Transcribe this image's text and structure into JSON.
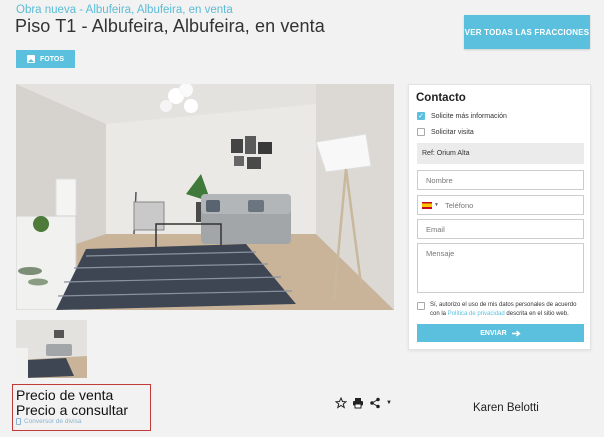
{
  "breadcrumb": "Obra nueva - Albufeira, Albufeira, en venta",
  "title": "Piso T1 - Albufeira, Albufeira, en venta",
  "all_fractions_button": "VER TODAS LAS FRACCIONES",
  "photos_button": "FOTOS",
  "contact": {
    "heading": "Contacto",
    "option_info": "Solicite más información",
    "option_info_checked": true,
    "option_visit": "Solicitar visita",
    "option_visit_checked": false,
    "reference": "Ref: Orium Alta",
    "name_placeholder": "Nombre",
    "phone_placeholder": "Teléfono",
    "email_placeholder": "Email",
    "message_placeholder": "Mensaje",
    "privacy_text_1": "Sí, autorizo el uso de mis datos personales de acuerdo con la ",
    "privacy_link": "Política de privacidad",
    "privacy_text_2": " descrita en el sitio web.",
    "send_button": "ENVIAR"
  },
  "price": {
    "label": "Precio de venta",
    "value": "Precio a consultar",
    "converter": "Conversor de divisa"
  },
  "actions": [
    "star-icon",
    "print-icon",
    "share-icon"
  ],
  "agent_name": "Karen Belotti",
  "colors": {
    "accent": "#5bc0de",
    "highlight_border": "#c23a3a"
  }
}
